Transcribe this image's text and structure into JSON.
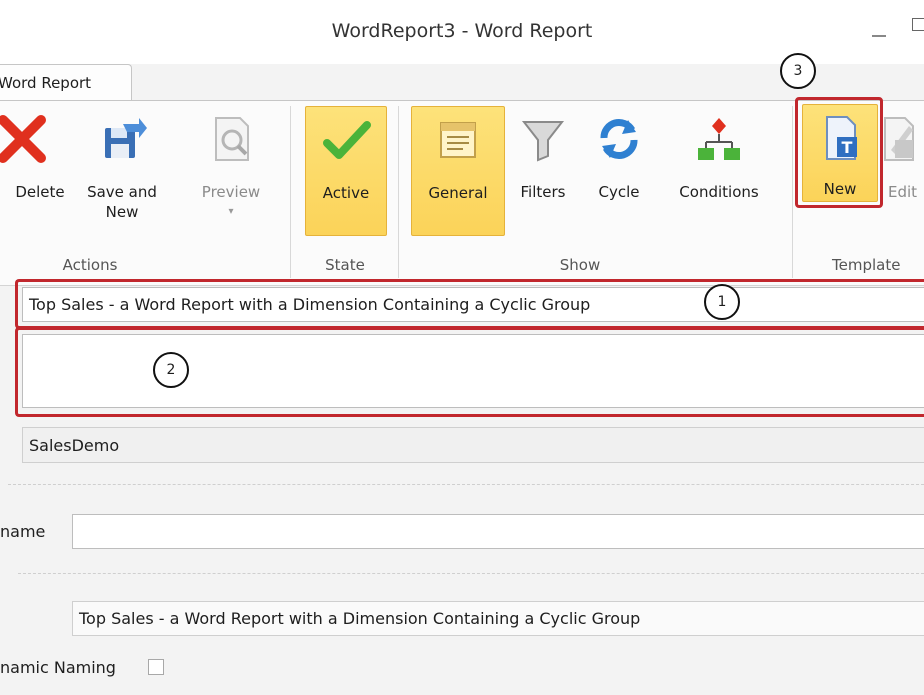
{
  "window": {
    "title": "WordReport3 - Word Report"
  },
  "ribbon": {
    "tab_label": "Word Report",
    "groups": {
      "actions": "Actions",
      "state": "State",
      "show": "Show",
      "template": "Template"
    },
    "buttons": {
      "delete": "Delete",
      "save_new_1": "Save and",
      "save_new_2": "New",
      "preview": "Preview",
      "active": "Active",
      "general": "General",
      "filters": "Filters",
      "cycle": "Cycle",
      "conditions": "Conditions",
      "new": "New",
      "edit": "Edit"
    }
  },
  "form": {
    "name_value": "Top Sales - a Word Report with a Dimension Containing a Cyclic Group",
    "description_value": "",
    "database_value": "SalesDemo",
    "name_label": "name",
    "name_field_value": "",
    "caption_value": "Top Sales - a Word Report with a Dimension Containing a Cyclic Group",
    "dynamic_naming_label": "namic Naming"
  },
  "callouts": {
    "one": "1",
    "two": "2",
    "three": "3"
  },
  "colors": {
    "highlight": "#fbd359",
    "callout_border": "#c1272d",
    "delete_red": "#e0301e"
  }
}
